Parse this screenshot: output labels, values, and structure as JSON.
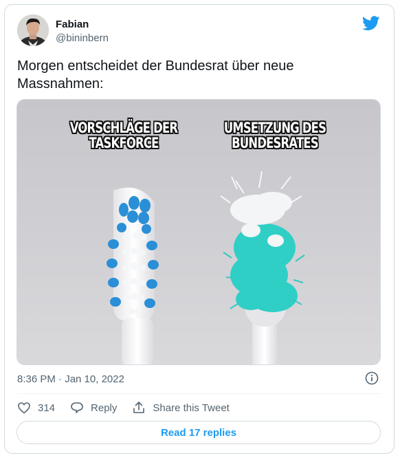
{
  "author": {
    "name": "Fabian",
    "handle": "@bininbern"
  },
  "tweet": {
    "text": "Morgen entscheidet der Bundesrat über neue Massnahmen:"
  },
  "media": {
    "caption_left": "VORSCHLÄGE DER TASKFORCE",
    "caption_right": "UMSETZUNG DES BUNDESRATES"
  },
  "timestamp": "8:36 PM · Jan 10, 2022",
  "actions": {
    "likes": "314",
    "reply_label": "Reply",
    "share_label": "Share this Tweet"
  },
  "read_replies": "Read 17 replies",
  "colors": {
    "accent": "#1d9bf0",
    "muted": "#536471",
    "border": "#cfd9de"
  },
  "icons": [
    "twitter-bird-icon",
    "info-icon",
    "heart-icon",
    "reply-icon",
    "share-icon"
  ]
}
